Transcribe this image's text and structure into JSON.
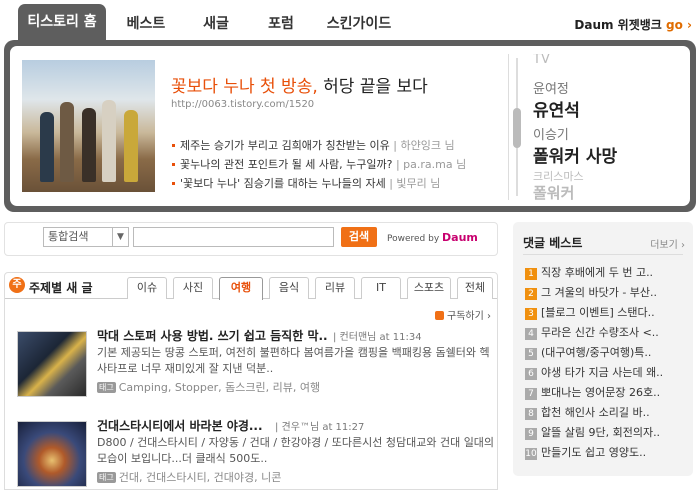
{
  "nav": {
    "tabs": [
      "티스토리 홈",
      "베스트",
      "새글",
      "포럼",
      "스킨가이드"
    ],
    "right_label": "Daum 위젯뱅크",
    "right_go": "go ›"
  },
  "feature": {
    "title_highlight": "꽃보다 누나 첫 방송,",
    "title_rest": " 허당 끝을 보다",
    "url": "http://0063.tistory.com/1520",
    "items": [
      {
        "text": "제주는 승기가 부리고 김희애가 칭찬받는 이유",
        "by": " | 하얀잉크 님"
      },
      {
        "text": "꽃누나의 관전 포인트가 될 세 사람, 누구일까?",
        "by": " | pa.ra.ma 님"
      },
      {
        "text": "'꽃보다 누나' 짐승기를 대하는 누나들의 자세",
        "by": " | 빛무리 님"
      }
    ],
    "keywords": {
      "k0": "TV",
      "k1": "윤여정",
      "k2": "유연석",
      "k3": "이승기",
      "k4": "폴워커 사망",
      "k5": "크리스마스",
      "k6": "폴워커"
    }
  },
  "search": {
    "select_value": "통합검색",
    "button": "검색",
    "powered_by": "Powered by",
    "powered_brand": "Daum"
  },
  "topic": {
    "icon_text": "주",
    "label": "주제별 새 글",
    "tabs": [
      "이슈",
      "사진",
      "여행",
      "음식",
      "리뷰",
      "IT",
      "스포츠",
      "전체"
    ],
    "subscribe": "구독하기 ›",
    "tag_badge": "태그",
    "posts": [
      {
        "title": "막대 스토퍼 사용 방법. 쓰기 쉽고 듬직한 막..",
        "meta": " | 컨터맨님 at 11:34",
        "desc": "기본 제공되는 땅콩 스토퍼, 여전히 불편하다 봄여름가을 캠핑을 백패킹용 돔쉘터와 헥사타프로 너무 재미있게 잘 지낸 덕분..",
        "tags": "Camping, Stopper, 돔스크린, 리뷰, 여행"
      },
      {
        "title": "건대스타시티에서 바라본 야경...",
        "meta": " | 견우™님 at 11:27",
        "desc": "D800 / 건대스타시티 / 자양동 / 건대 / 한강야경 / 또다른시선 청담대교와 건대 일대의 모습이 보입니다...더 클래식 500도..",
        "tags": "건대, 건대스타시티, 건대야경, 니콘"
      }
    ]
  },
  "comments": {
    "title": "댓글 베스트",
    "more": "더보기 ›",
    "items": [
      "직장 후배에게 두 번 고..",
      "그 겨울의 바닷가 - 부산..",
      "[블로그 이벤트] 스탠다..",
      "무라은 신간 수량조사 <..",
      "(대구여행/중구여행)특..",
      "야생 타가 지금 사는데 왜..",
      "뽀대나는 영어문장 26호..",
      "합천 해인사 소리길 바..",
      "알뜰 살림 9단, 회전의자..",
      "만들기도 쉽고 영양도.."
    ]
  },
  "colors": {
    "accent": "#e8500a",
    "nav_dark": "#5e5e5e",
    "search_button": "#f07016"
  }
}
